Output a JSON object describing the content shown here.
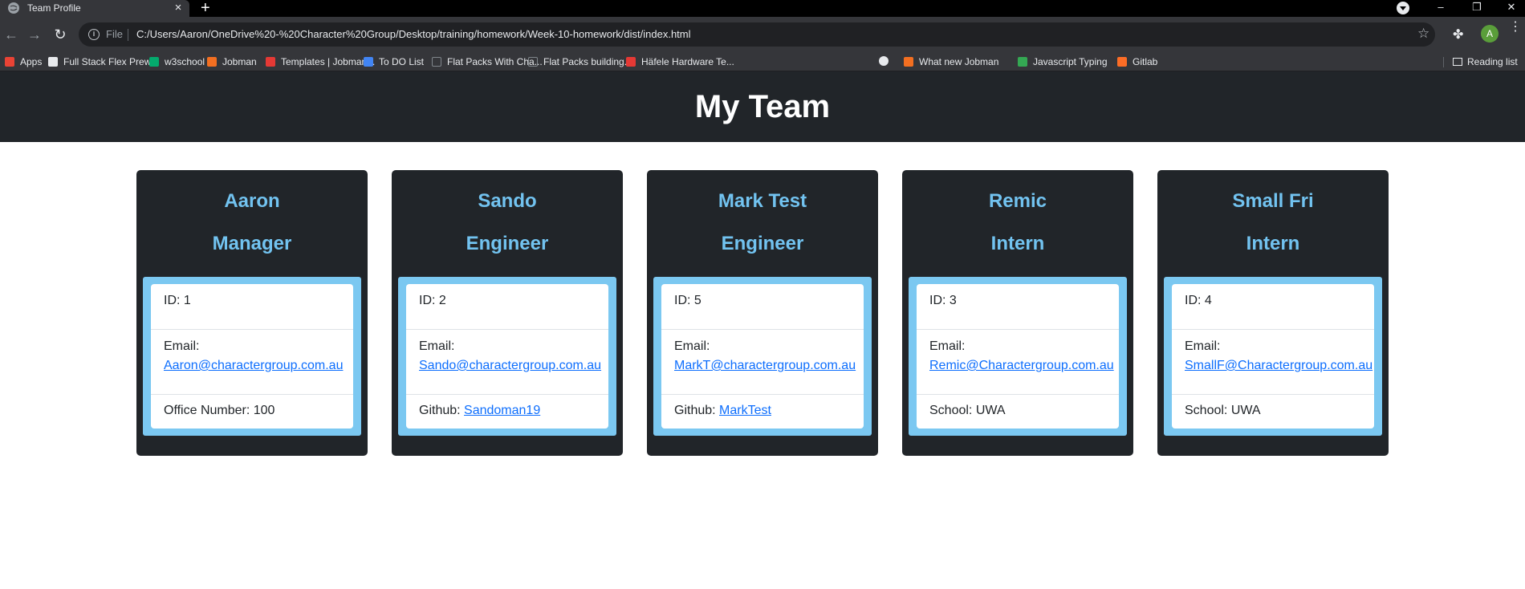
{
  "browser": {
    "tab_title": "Team Profile",
    "tab_close": "×",
    "new_tab": "+",
    "scheme_label": "File",
    "url": "C:/Users/Aaron/OneDrive%20-%20Character%20Group/Desktop/training/homework/Week-10-homework/dist/index.html",
    "profile_initial": "A",
    "bookmarks": [
      {
        "label": "Apps",
        "icon": "apps-grid-icon",
        "color": "#ea4335"
      },
      {
        "label": "Full Stack Flex Prew...",
        "icon": "book-icon",
        "color": "#e8eaed"
      },
      {
        "label": "w3school",
        "icon": "w3schools-icon",
        "color": "#04aa6d"
      },
      {
        "label": "Jobman",
        "icon": "code-braces-icon",
        "color": "#f36f21"
      },
      {
        "label": "Templates | Jobman...",
        "icon": "bars-icon",
        "color": "#e53935"
      },
      {
        "label": "To DO List",
        "icon": "bookmark-icon",
        "color": "#4285f4"
      },
      {
        "label": "Flat Packs With Cha...",
        "icon": "gray-doc-icon",
        "color": "#80868b"
      },
      {
        "label": "Flat Packs building...",
        "icon": "gray-doc-icon",
        "color": "#80868b"
      },
      {
        "label": "Häfele Hardware Te...",
        "icon": "hafele-icon",
        "color": "#e53935"
      },
      {
        "label": "",
        "icon": "globe-icon",
        "color": "#e8eaed"
      },
      {
        "label": "What new Jobman",
        "icon": "code-braces-icon",
        "color": "#f36f21"
      },
      {
        "label": "Javascript Typing",
        "icon": "t-letter-icon",
        "color": "#34a853"
      },
      {
        "label": "Gitlab",
        "icon": "gitlab-icon",
        "color": "#fc6d26"
      }
    ],
    "reading_list": "Reading list"
  },
  "page": {
    "title": "My Team",
    "id_prefix": "ID: ",
    "email_label": "Email:",
    "members": [
      {
        "name": "Aaron",
        "role": "Manager",
        "id": "1",
        "email": "Aaron@charactergroup.com.au",
        "extra_label": "Office Number: 100",
        "extra_link": ""
      },
      {
        "name": "Sando",
        "role": "Engineer",
        "id": "2",
        "email": "Sando@charactergroup.com.au",
        "extra_label": "Github: ",
        "extra_link": "Sandoman19"
      },
      {
        "name": "Mark Test",
        "role": "Engineer",
        "id": "5",
        "email": "MarkT@charactergroup.com.au",
        "extra_label": "Github: ",
        "extra_link": "MarkTest"
      },
      {
        "name": "Remic",
        "role": "Intern",
        "id": "3",
        "email": "Remic@Charactergroup.com.au",
        "extra_label": "School: UWA",
        "extra_link": ""
      },
      {
        "name": "Small Fri",
        "role": "Intern",
        "id": "4",
        "email": "SmallF@Charactergroup.com.au",
        "extra_label": "School: UWA",
        "extra_link": ""
      }
    ]
  },
  "colors": {
    "header_bg": "#212529",
    "card_bg": "#212529",
    "accent": "#72c3f0",
    "card_body_bg": "#7bc8f1",
    "link": "#0d6efd"
  }
}
